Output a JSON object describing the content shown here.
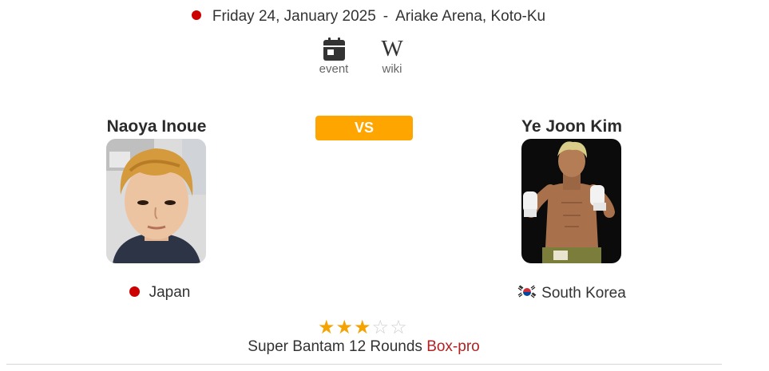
{
  "event": {
    "date": "Friday 24, January 2025",
    "separator": "-",
    "venue": "Ariake Arena, Koto-Ku",
    "status_color": "#cc0000"
  },
  "links": {
    "event_label": "event",
    "event_icon": "calendar-icon",
    "wiki_label": "wiki",
    "wiki_icon": "wikipedia-w-icon",
    "wiki_glyph": "W"
  },
  "fighters": {
    "left": {
      "name": "Naoya Inoue",
      "country": "Japan",
      "flag_icon": "japan-flag-icon"
    },
    "right": {
      "name": "Ye Joon Kim",
      "country": "South Korea",
      "flag_icon": "south-korea-flag-icon"
    }
  },
  "versus": {
    "label": "VS",
    "color": "#ffa500"
  },
  "rating": {
    "value": 3,
    "max": 5,
    "filled_color": "#f4a300",
    "empty_color": "#cfcfcf"
  },
  "bout": {
    "description": "Super Bantam 12 Rounds",
    "type": "Box-pro",
    "type_color": "#b22222"
  }
}
